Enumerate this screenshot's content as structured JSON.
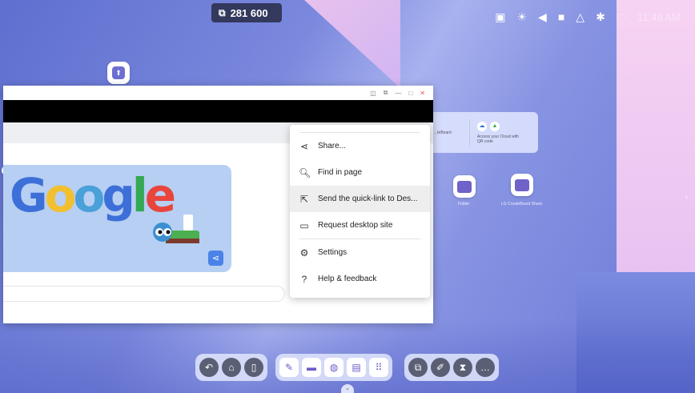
{
  "status": {
    "room_code": "281 600",
    "clock": "11:46 AM",
    "icons": [
      "screen-share-icon",
      "brightness-icon",
      "volume-icon",
      "camera-icon",
      "cloud-icon",
      "network-icon",
      "wifi-icon"
    ]
  },
  "desktop": {
    "cloud_card": {
      "left_text": "...teBoard",
      "right_text": "Access your Cloud with QR code"
    },
    "apps": [
      {
        "label": "Folder"
      },
      {
        "label": "LG CreateBoard Share"
      }
    ]
  },
  "menu": {
    "items": [
      {
        "label": "Share...",
        "icon": "share-icon"
      },
      {
        "label": "Find in page",
        "icon": "find-in-page-icon"
      },
      {
        "label": "Send the quick-link to Des...",
        "icon": "send-to-device-icon",
        "highlighted": true
      },
      {
        "label": "Request desktop site",
        "icon": "desktop-icon"
      },
      {
        "label": "Settings",
        "icon": "gear-icon"
      },
      {
        "label": "Help & feedback",
        "icon": "help-icon"
      }
    ]
  },
  "doodle": {
    "text": "Google"
  },
  "dock": {
    "groups": [
      [
        "back-icon",
        "home-icon",
        "multitask-icon"
      ],
      [
        "whiteboard-icon",
        "folder-icon",
        "browser-icon",
        "share-icon",
        "apps-icon"
      ],
      [
        "screen-capture-icon",
        "pen-icon",
        "timer-icon",
        "more-icon"
      ]
    ]
  }
}
